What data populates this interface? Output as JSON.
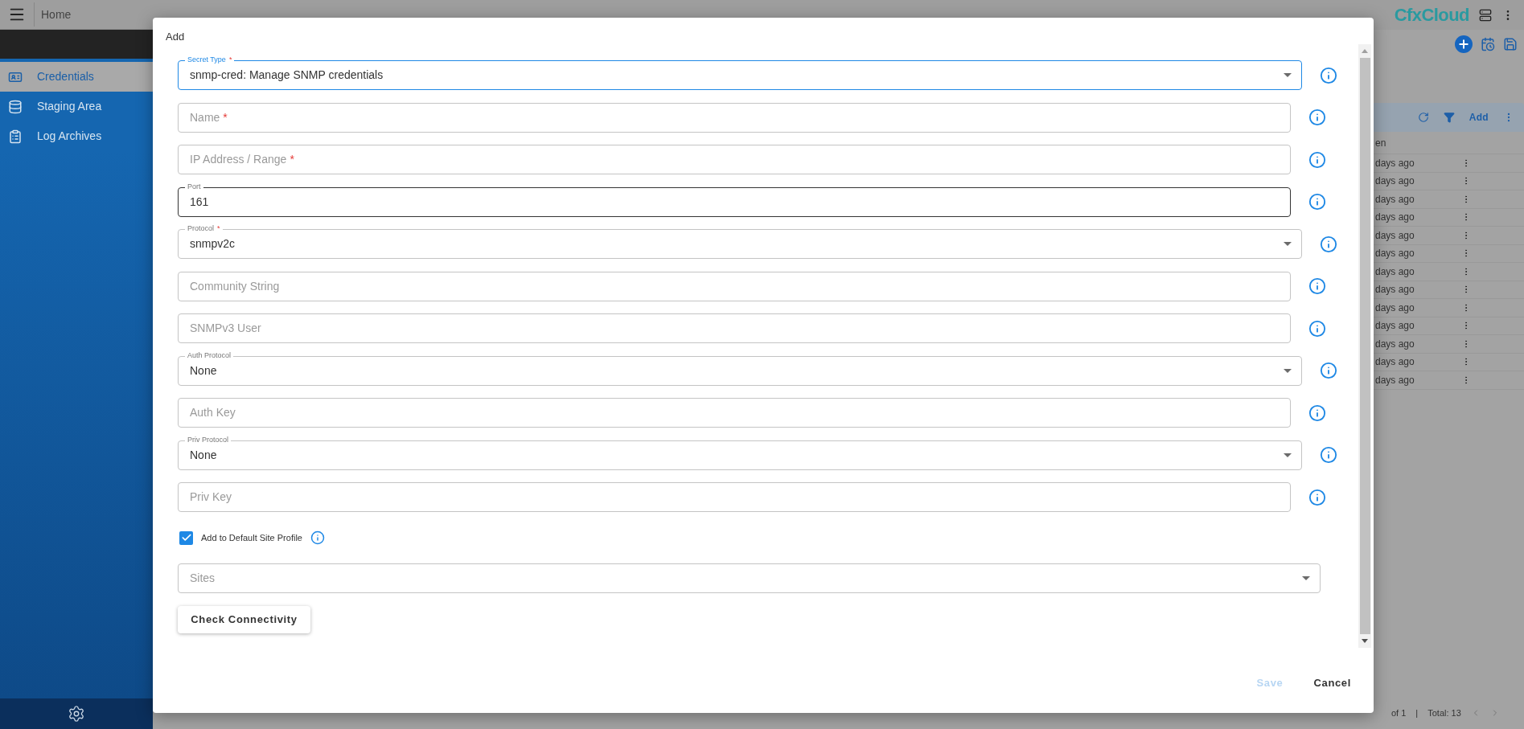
{
  "topbar": {
    "title": "Home",
    "logo": "CfxCloud"
  },
  "sidebar": {
    "items": [
      {
        "label": "Credentials",
        "selected": true
      },
      {
        "label": "Staging Area",
        "selected": false
      },
      {
        "label": "Log Archives",
        "selected": false
      }
    ]
  },
  "background_toolbar": {
    "add": "Add"
  },
  "background_table": {
    "column_1": "en",
    "rows": [
      "days ago",
      "days ago",
      "days ago",
      "days ago",
      "days ago",
      "days ago",
      "days ago",
      "days ago",
      "days ago",
      "days ago",
      "days ago",
      "days ago",
      "days ago"
    ]
  },
  "pagination": {
    "pages": "of 1",
    "separator": "|",
    "total": "Total: 13"
  },
  "dialog": {
    "title": "Add",
    "fields": [
      {
        "kind": "select",
        "label": "Secret Type",
        "asterisk": "*",
        "value": "snmp-cred: Manage SNMP credentials",
        "focused": true,
        "hovered": false
      },
      {
        "kind": "text",
        "placeholder": "Name",
        "asterisk": "*",
        "focused": false,
        "hovered": false
      },
      {
        "kind": "text",
        "placeholder": "IP Address / Range",
        "asterisk": "*",
        "focused": false,
        "hovered": false
      },
      {
        "kind": "text",
        "label": "Port",
        "value": "161",
        "focused": false,
        "hovered": true
      },
      {
        "kind": "select",
        "label": "Protocol",
        "asterisk": "*",
        "value": "snmpv2c",
        "focused": false,
        "hovered": false
      },
      {
        "kind": "text",
        "placeholder": "Community String",
        "focused": false,
        "hovered": false
      },
      {
        "kind": "text",
        "placeholder": "SNMPv3 User",
        "focused": false,
        "hovered": false
      },
      {
        "kind": "select",
        "label": "Auth Protocol",
        "value": "None",
        "focused": false,
        "hovered": false
      },
      {
        "kind": "text",
        "placeholder": "Auth Key",
        "focused": false,
        "hovered": false
      },
      {
        "kind": "select",
        "label": "Priv Protocol",
        "value": "None",
        "focused": false,
        "hovered": false
      },
      {
        "kind": "text",
        "placeholder": "Priv Key",
        "focused": false,
        "hovered": false
      }
    ],
    "checkbox": {
      "label": "Add to Default Site Profile",
      "checked": true
    },
    "sites": {
      "placeholder": "Sites"
    },
    "check_button": "Check Connectivity",
    "buttons": [
      {
        "label": "Save",
        "disabled": true
      },
      {
        "label": "Cancel",
        "disabled": false
      }
    ]
  }
}
